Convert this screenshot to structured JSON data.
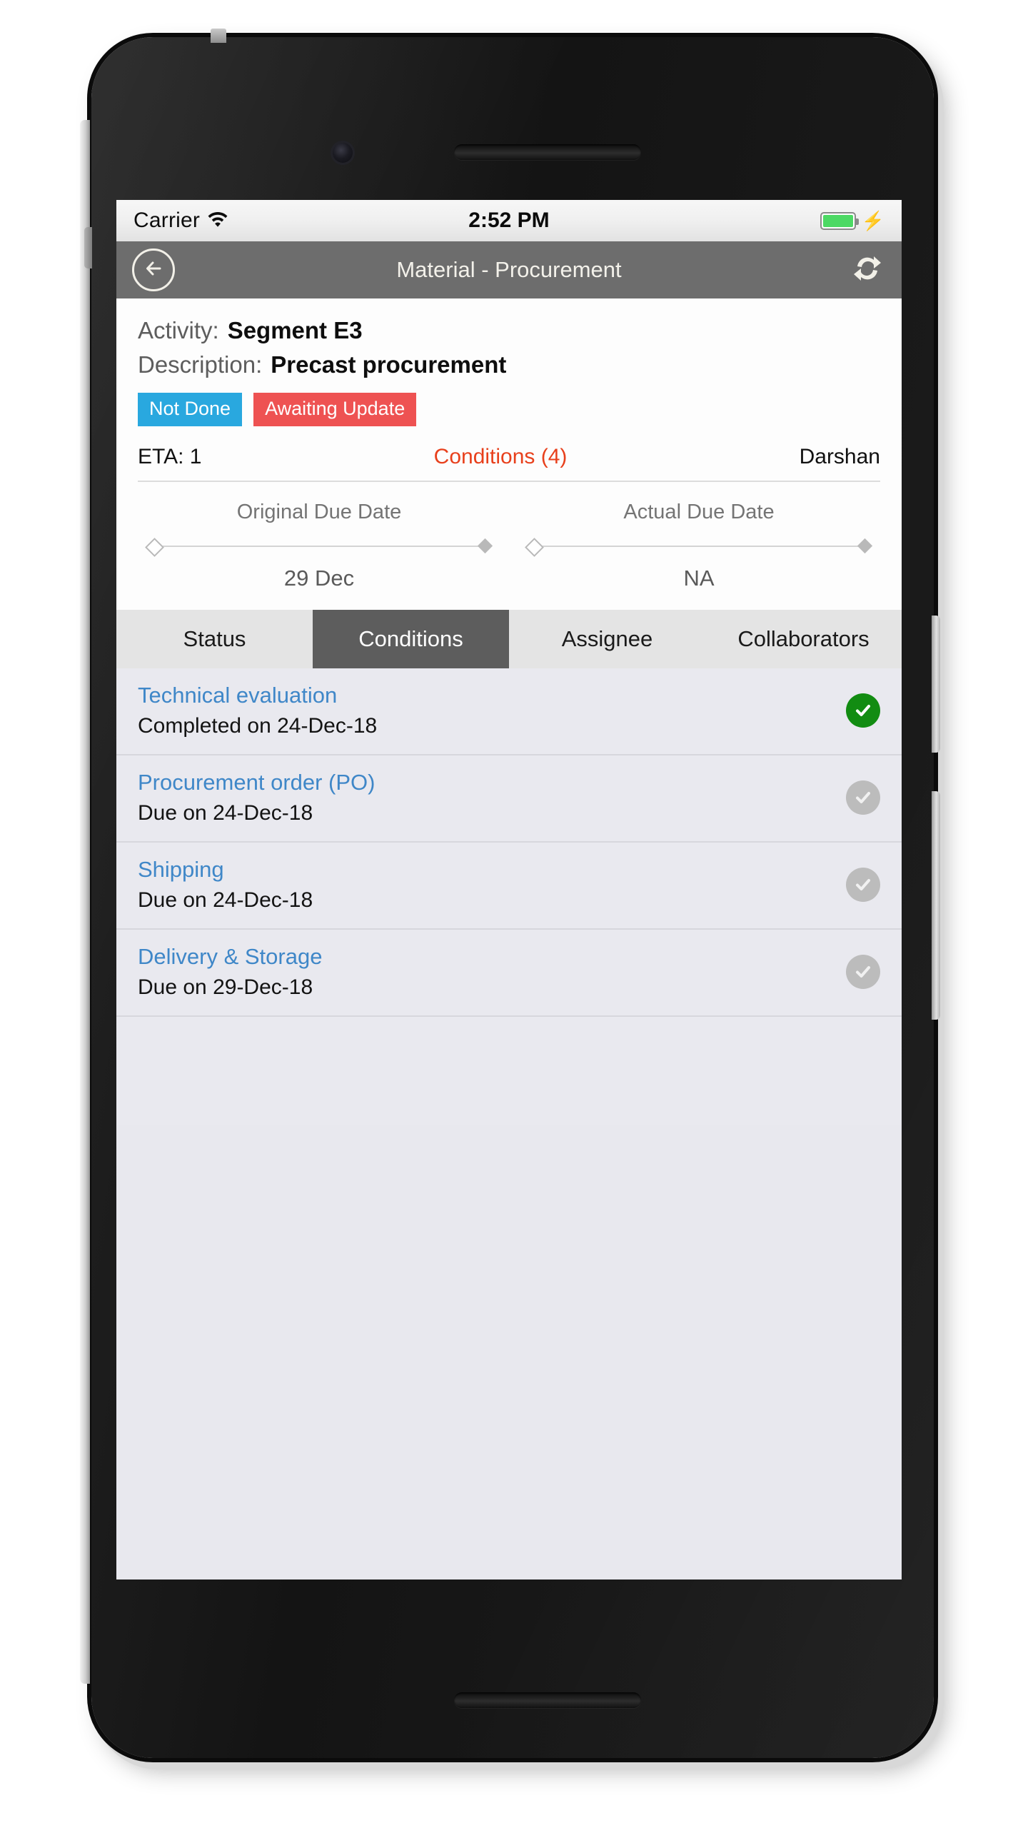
{
  "status_bar": {
    "carrier": "Carrier",
    "wifi_icon": "wifi-icon",
    "time": "2:52 PM",
    "battery_icon": "battery-icon",
    "charging_icon": "lightning-bolt-icon"
  },
  "nav_bar": {
    "back_icon": "back-arrow-icon",
    "title": "Material - Procurement",
    "refresh_icon": "refresh-icon"
  },
  "info": {
    "activity_label": "Activity:",
    "activity_value": "Segment E3",
    "description_label": "Description:",
    "description_value": "Precast procurement",
    "badges": [
      {
        "label": "Not Done",
        "color": "#29a8df"
      },
      {
        "label": "Awaiting Update",
        "color": "#ee5252"
      }
    ],
    "eta": "ETA: 1",
    "conditions_link": "Conditions (4)",
    "conditions_link_color": "#e8401c",
    "owner": "Darshan"
  },
  "due_dates": [
    {
      "title": "Original Due Date",
      "value": "29 Dec"
    },
    {
      "title": "Actual Due Date",
      "value": "NA"
    }
  ],
  "tabs": [
    {
      "label": "Status",
      "active": false
    },
    {
      "label": "Conditions",
      "active": true
    },
    {
      "label": "Assignee",
      "active": false
    },
    {
      "label": "Collaborators",
      "active": false
    }
  ],
  "conditions": [
    {
      "title": "Technical evaluation",
      "status_text": "Completed on 24-Dec-18",
      "completed": true
    },
    {
      "title": "Procurement order (PO)",
      "status_text": "Due on 24-Dec-18",
      "completed": false
    },
    {
      "title": "Shipping",
      "status_text": "Due on 24-Dec-18",
      "completed": false
    },
    {
      "title": "Delivery & Storage",
      "status_text": "Due on 29-Dec-18",
      "completed": false
    }
  ],
  "colors": {
    "nav_bar": "#6d6d6d",
    "tab_active": "#5d5d5d",
    "link_blue": "#3f87c8",
    "check_done": "#128c12",
    "check_pending": "#bcbcbc",
    "list_background": "#e9e9ef"
  }
}
